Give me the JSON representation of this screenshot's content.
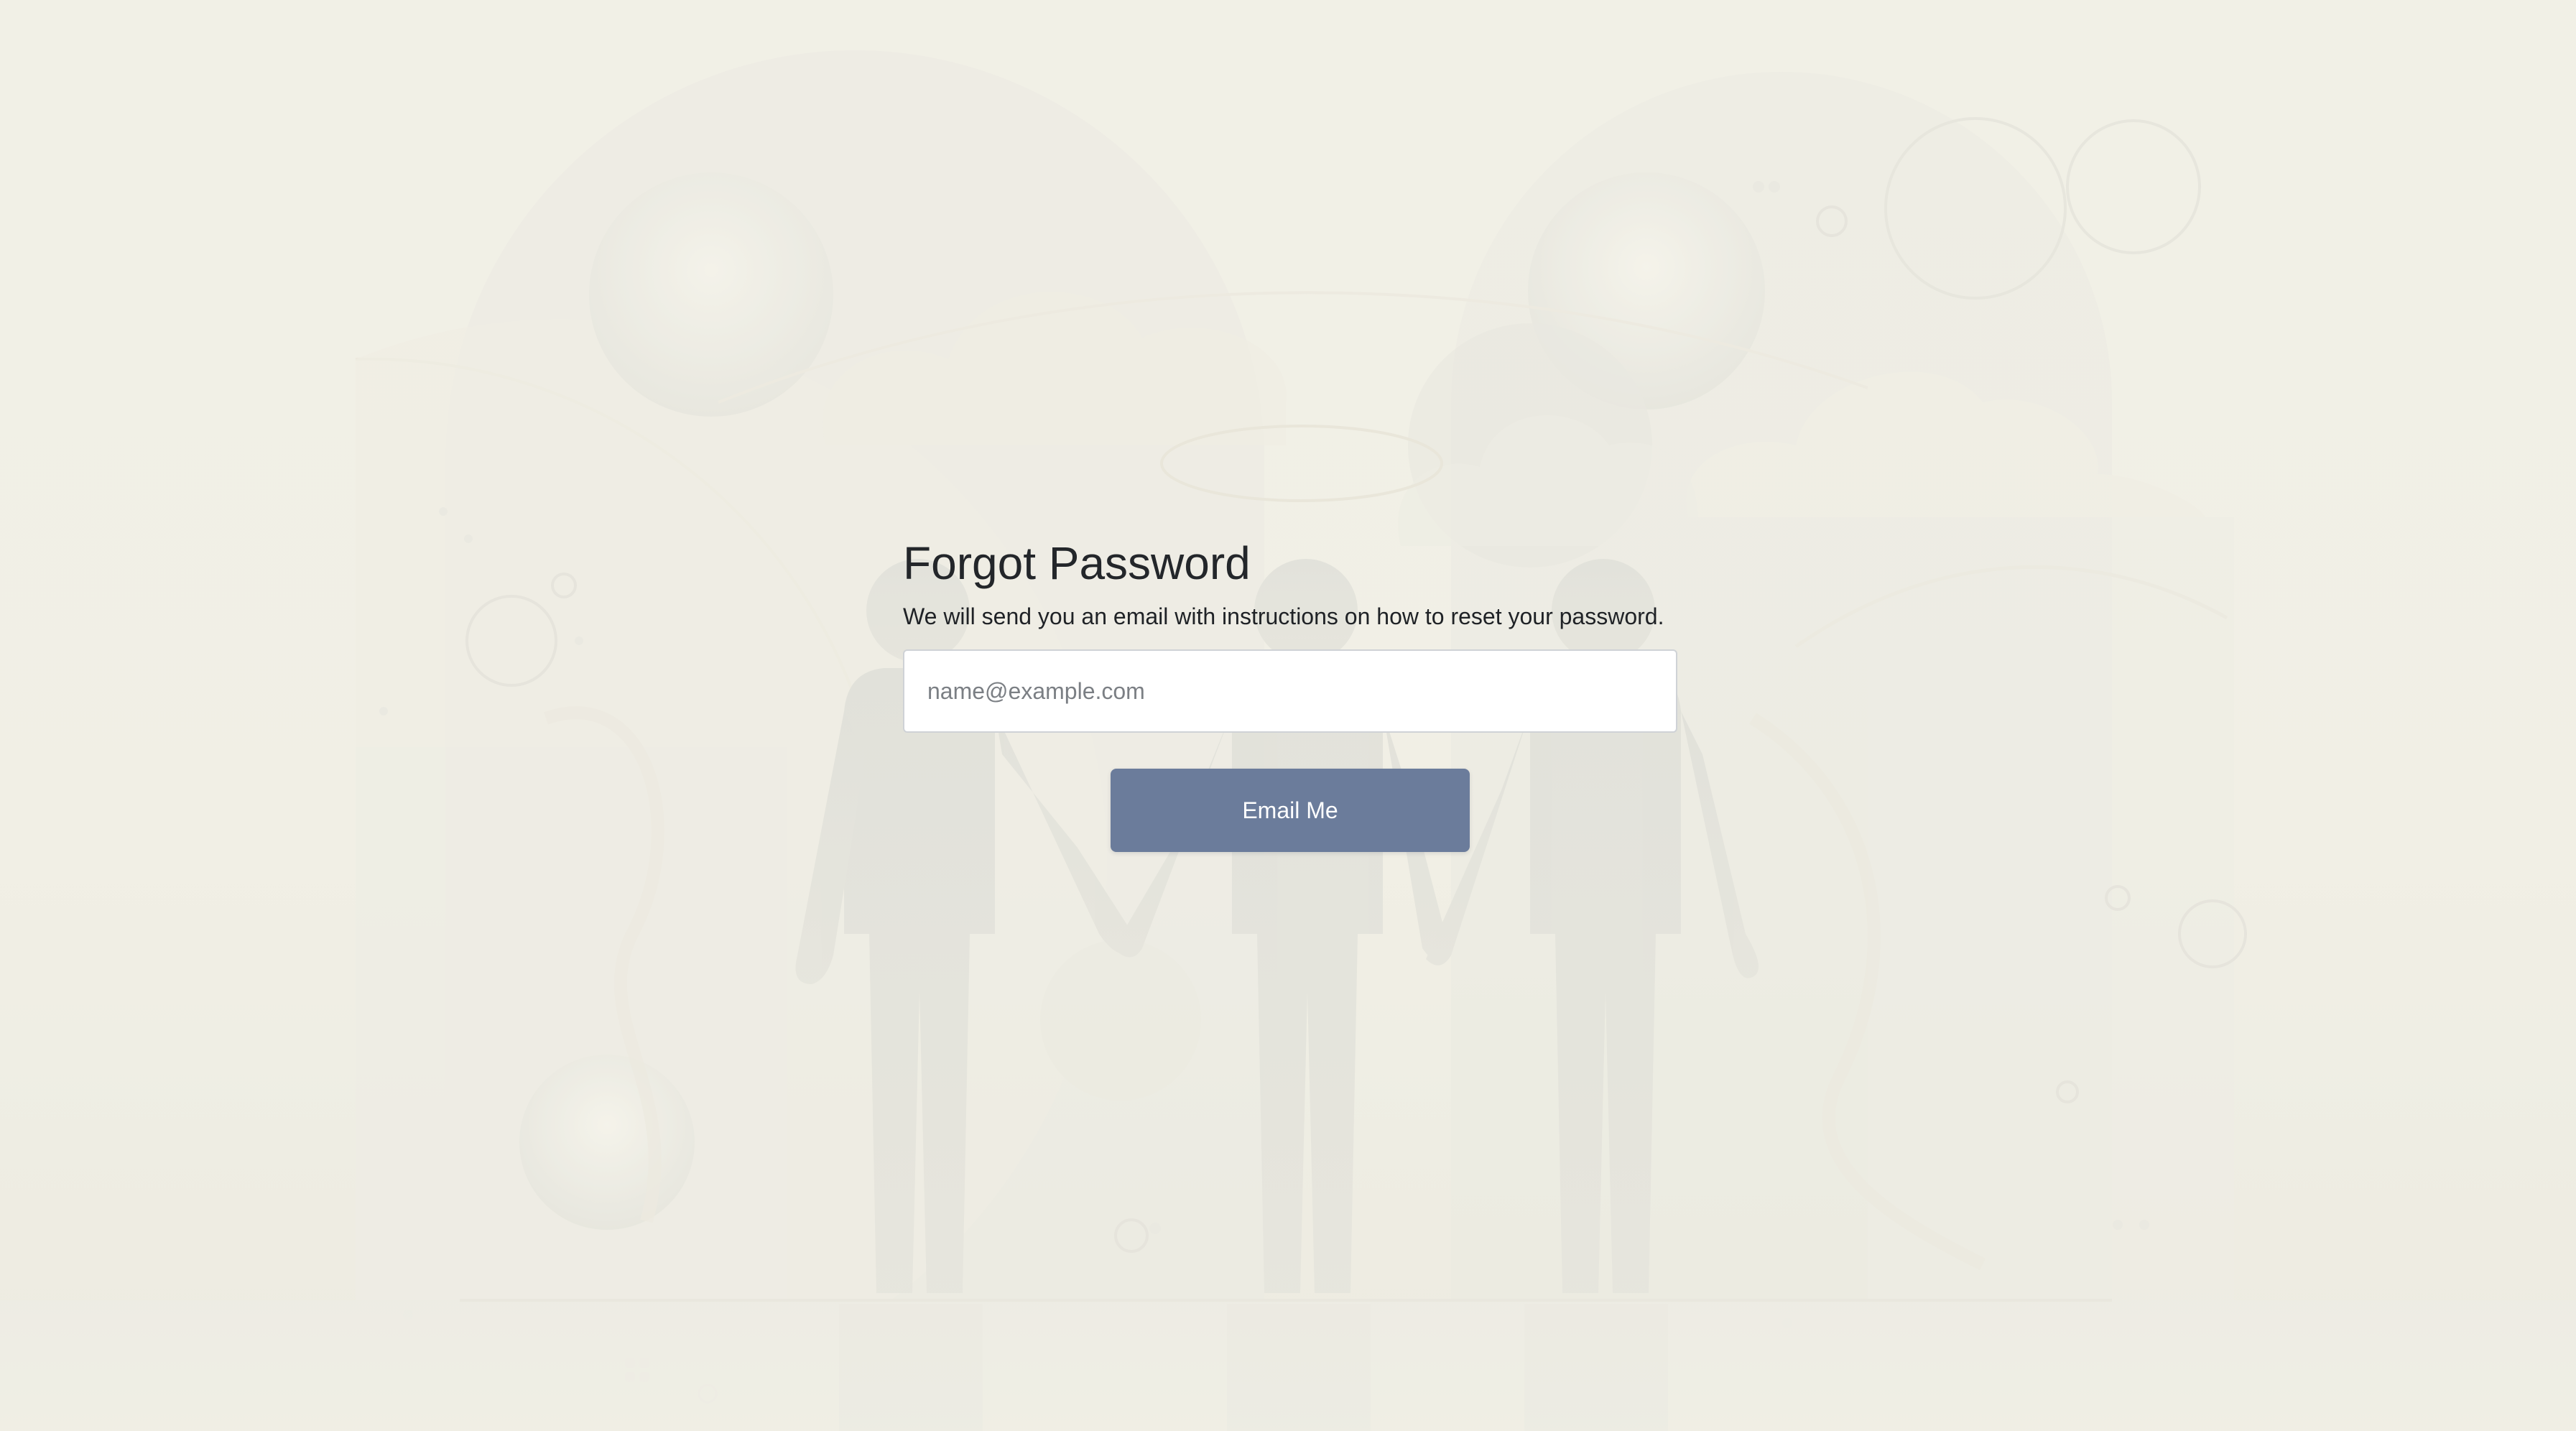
{
  "page": {
    "title": "Forgot Password",
    "description": "We will send you an email with instructions on how to reset your password."
  },
  "form": {
    "email_placeholder": "name@example.com",
    "email_value": "",
    "submit_label": "Email Me"
  },
  "colors": {
    "background": "#f1efe5",
    "button": "#6b7c9b",
    "button_text": "#ffffff",
    "heading": "#23262a"
  }
}
